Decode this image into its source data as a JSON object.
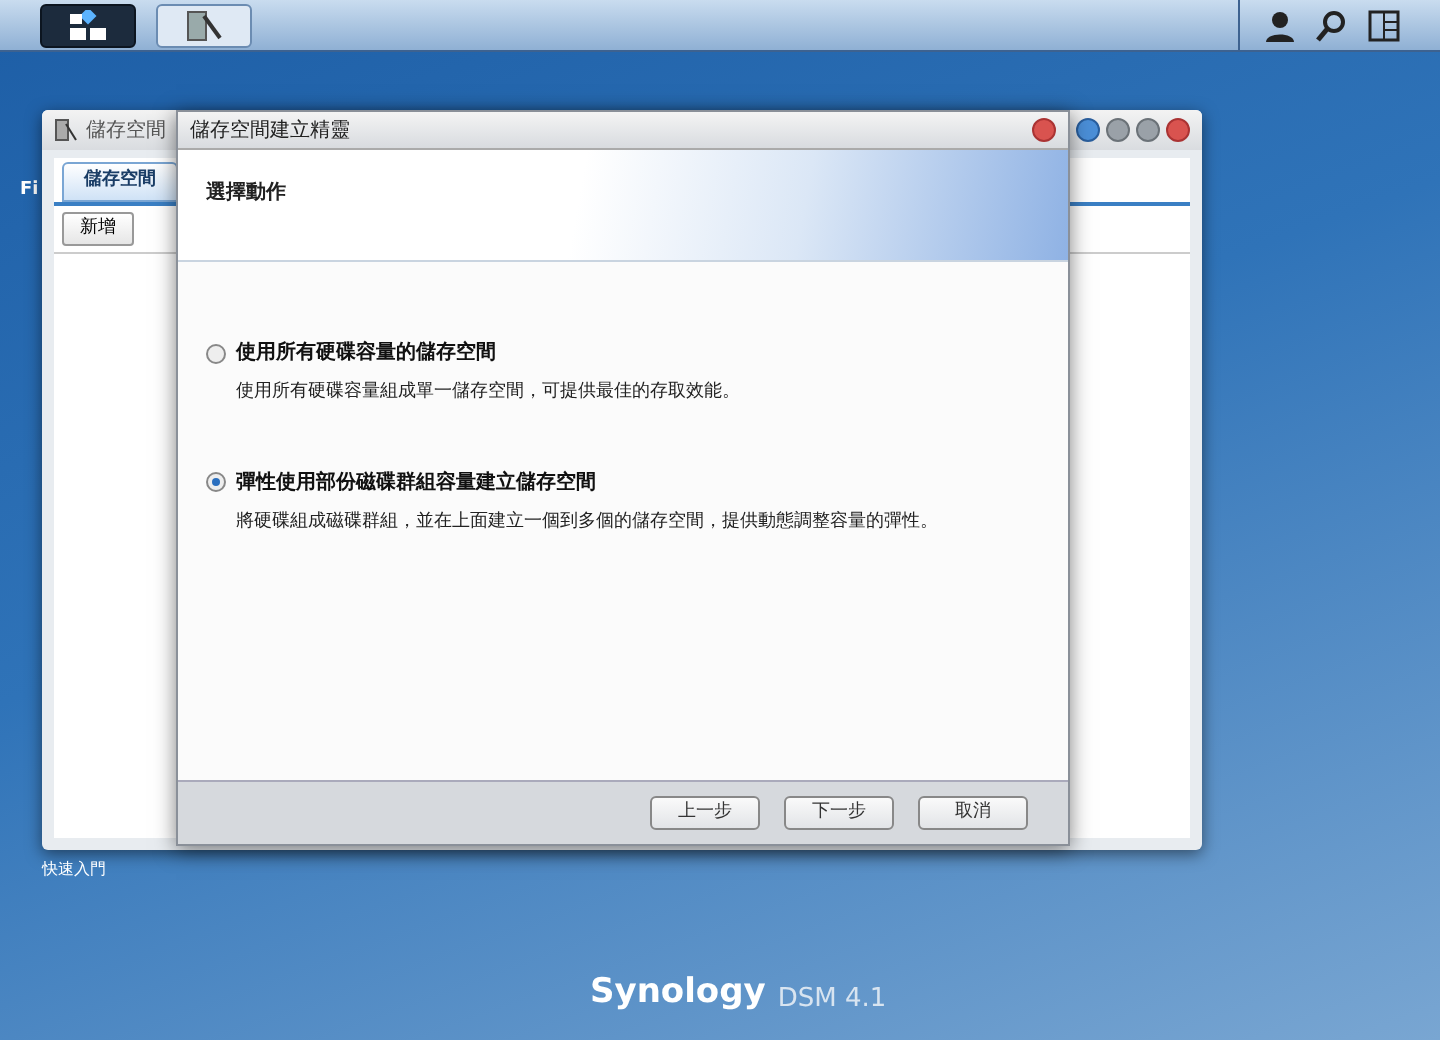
{
  "taskbar": {
    "buttons": [
      {
        "kind": "main-menu",
        "selected": true
      },
      {
        "kind": "storage-app",
        "selected": false
      }
    ]
  },
  "desktop": {
    "label_cut": "Fi",
    "shortcut_label": "快速入門",
    "brand": {
      "name": "Synology",
      "product": "DSM 4.1"
    }
  },
  "background_window": {
    "title": "儲存空間",
    "tabs": [
      {
        "label": "儲存空間",
        "selected": true
      }
    ],
    "toolbar": [
      "新增"
    ]
  },
  "wizard": {
    "title": "儲存空間建立精靈",
    "heading": "選擇動作",
    "options": [
      {
        "label": "使用所有硬碟容量的儲存空間",
        "description": "使用所有硬碟容量組成單一儲存空間，可提供最佳的存取效能。",
        "selected": false
      },
      {
        "label": "彈性使用部份磁碟群組容量建立儲存空間",
        "description": "將硬碟組成磁碟群組，並在上面建立一個到多個的儲存空間，提供動態調整容量的彈性。",
        "selected": true
      }
    ],
    "buttons": [
      "上一步",
      "下一步",
      "取消"
    ]
  }
}
